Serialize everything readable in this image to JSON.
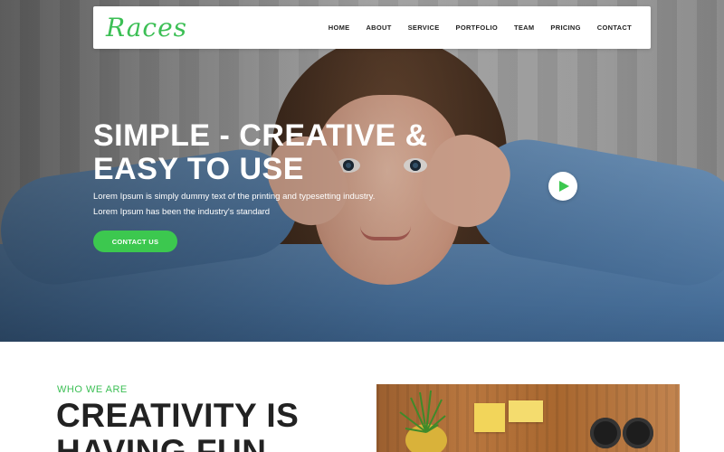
{
  "brand": {
    "logo": "Races",
    "accent": "#3cbf55"
  },
  "nav": {
    "items": [
      "HOME",
      "ABOUT",
      "SERVICE",
      "PORTFOLIO",
      "TEAM",
      "PRICING",
      "CONTACT"
    ]
  },
  "hero": {
    "headline_line1": "SIMPLE - CREATIVE &",
    "headline_line2": "EASY TO USE",
    "text_line1": "Lorem Ipsum is simply dummy text of the printing and typesetting industry.",
    "text_line2": "Lorem Ipsum has been the industry's standard",
    "cta_label": "CONTACT US",
    "cta_color": "#3cc84f",
    "play_icon": "play-icon"
  },
  "about": {
    "kicker": "WHO WE ARE",
    "title_line1": "CREATIVITY IS",
    "title_line2": "HAVING FUN"
  }
}
